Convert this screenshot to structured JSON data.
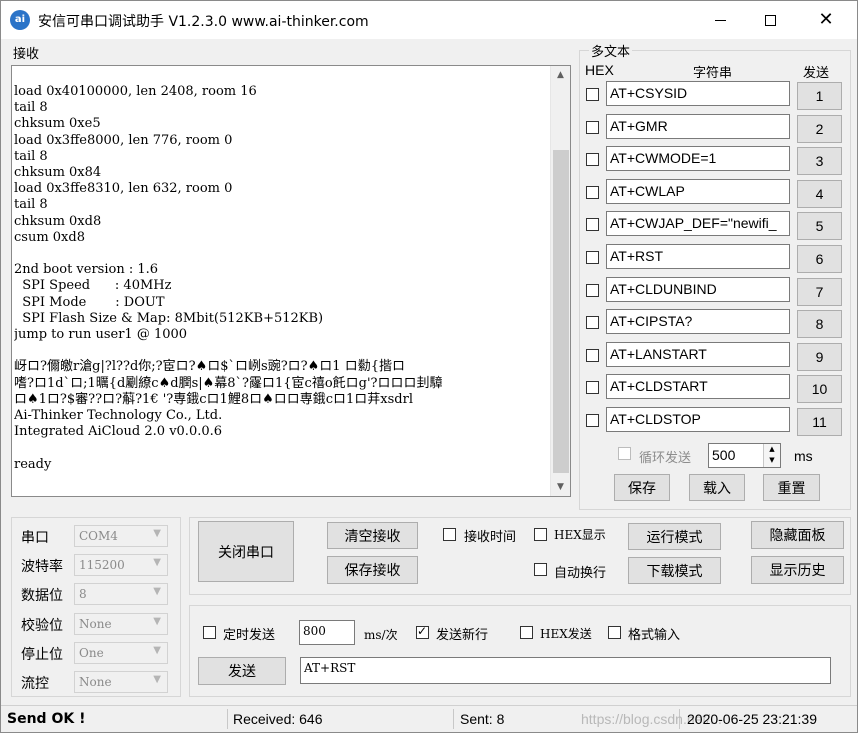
{
  "title": "安信可串口调试助手 V1.2.3.0    www.ai-thinker.com",
  "app_icon": "ai-thinker-logo-icon",
  "receive": {
    "label": "接收",
    "content": "load 0x40100000, len 2408, room 16\ntail 8\nchksum 0xe5\nload 0x3ffe8000, len 776, room 0\ntail 8\nchksum 0x84\nload 0x3ffe8310, len 632, room 0\ntail 8\nchksum 0xd8\ncsum 0xd8\n\n2nd boot version : 1.6\n  SPI Speed      : 40MHz\n  SPI Mode       : DOUT\n  SPI Flash Size & Map: 8Mbit(512KB+512KB)\njump to run user1 @ 1000\n\n岈ロ?儞皦r滄g|?l??d你;?宦ロ?♠ロ$`ロ峢s豌?ロ?♠ロ1 ロ勬{揩ロ\n嗜?ロ1d`ロ;1曞{d劚繚c♠d膶s|♠幕8`?霳ロ1{宦c禧o飥ロg'?ロロロ刲騿\nロ♠1ロ?$審??ロ?蔛?1€ '?専鋨cロ1鯉8ロ♠ロロ専鋨cロ1ロ荓xsdrl\nAi-Thinker Technology Co., Ltd.\nIntegrated AiCloud 2.0 v0.0.0.6\n\nready"
  },
  "multi": {
    "label": "多文本",
    "hex_header": "HEX",
    "str_header": "字符串",
    "send_header": "发送",
    "rows": [
      {
        "text": "AT+CSYSID",
        "num": "1"
      },
      {
        "text": "AT+GMR",
        "num": "2"
      },
      {
        "text": "AT+CWMODE=1",
        "num": "3"
      },
      {
        "text": "AT+CWLAP",
        "num": "4"
      },
      {
        "text": "AT+CWJAP_DEF=\"newifi_",
        "num": "5"
      },
      {
        "text": "AT+RST",
        "num": "6"
      },
      {
        "text": "AT+CLDUNBIND",
        "num": "7"
      },
      {
        "text": "AT+CIPSTA?",
        "num": "8"
      },
      {
        "text": "AT+LANSTART",
        "num": "9"
      },
      {
        "text": "AT+CLDSTART",
        "num": "10"
      },
      {
        "text": "AT+CLDSTOP",
        "num": "11"
      }
    ],
    "loop_label": "循环发送",
    "loop_value": "500",
    "loop_unit": "ms",
    "save": "保存",
    "load": "载入",
    "reset": "重置"
  },
  "port": {
    "fields": [
      {
        "label": "串口",
        "value": "COM4"
      },
      {
        "label": "波特率",
        "value": "115200"
      },
      {
        "label": "数据位",
        "value": "8"
      },
      {
        "label": "校验位",
        "value": "None"
      },
      {
        "label": "停止位",
        "value": "One"
      },
      {
        "label": "流控",
        "value": "None"
      }
    ]
  },
  "controls": {
    "close_port": "关闭串口",
    "clear_recv": "清空接收",
    "save_recv": "保存接收",
    "recv_time": "接收时间",
    "hex_display": "HEX显示",
    "auto_wrap": "自动换行",
    "run_mode": "运行模式",
    "download_mode": "下载模式",
    "hide_panel": "隐藏面板",
    "show_history": "显示历史"
  },
  "send": {
    "timed_send": "定时发送",
    "interval": "800",
    "interval_unit": "ms/次",
    "send_newline": "发送新行",
    "send_newline_checked": true,
    "hex_send": "HEX发送",
    "format_input": "格式输入",
    "send_button": "发送",
    "send_text": "AT+RST"
  },
  "status": {
    "send_ok": "Send OK !",
    "received": "Received: 646",
    "sent": "Sent: 8",
    "datetime": "2020-06-25 23:21:39",
    "watermark": "https://blog.csdn.net/..."
  }
}
